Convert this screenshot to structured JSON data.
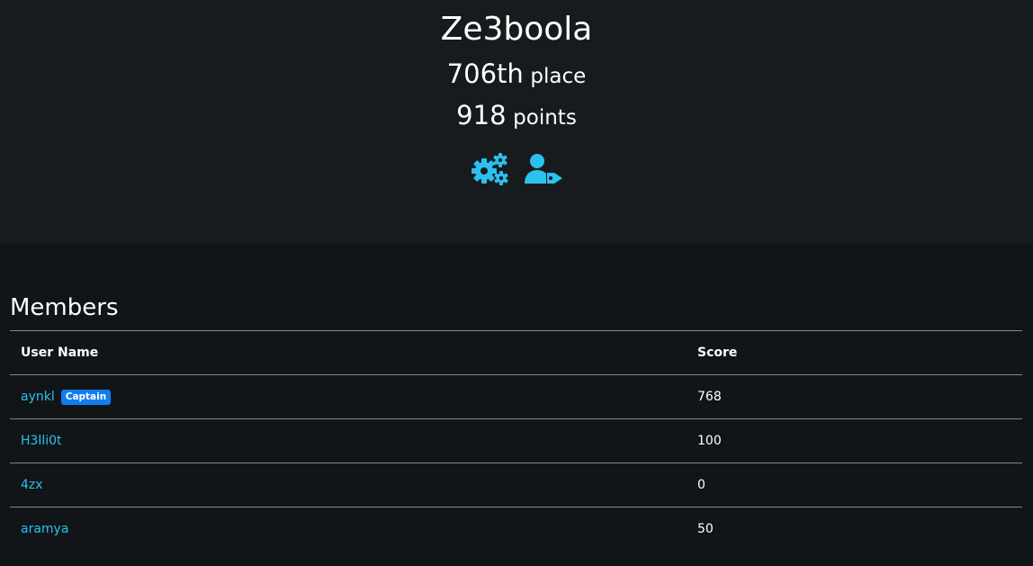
{
  "team": {
    "name": "Ze3boola",
    "place_value": "706th",
    "place_label": "place",
    "points_value": "918",
    "points_label": "points"
  },
  "actions": [
    {
      "icon": "settings-gears-icon"
    },
    {
      "icon": "user-tag-icon"
    }
  ],
  "members": {
    "title": "Members",
    "columns": [
      "User Name",
      "Score"
    ],
    "rows": [
      {
        "name": "aynkl",
        "badge": "Captain",
        "score": "768"
      },
      {
        "name": "H3lli0t",
        "badge": "",
        "score": "100"
      },
      {
        "name": "4zx",
        "badge": "",
        "score": "0"
      },
      {
        "name": "aramya",
        "badge": "",
        "score": "50"
      }
    ]
  },
  "colors": {
    "header_bg": "#171b1d",
    "page_bg": "#111518",
    "accent": "#2ac1ef",
    "badge": "#137cf0"
  }
}
